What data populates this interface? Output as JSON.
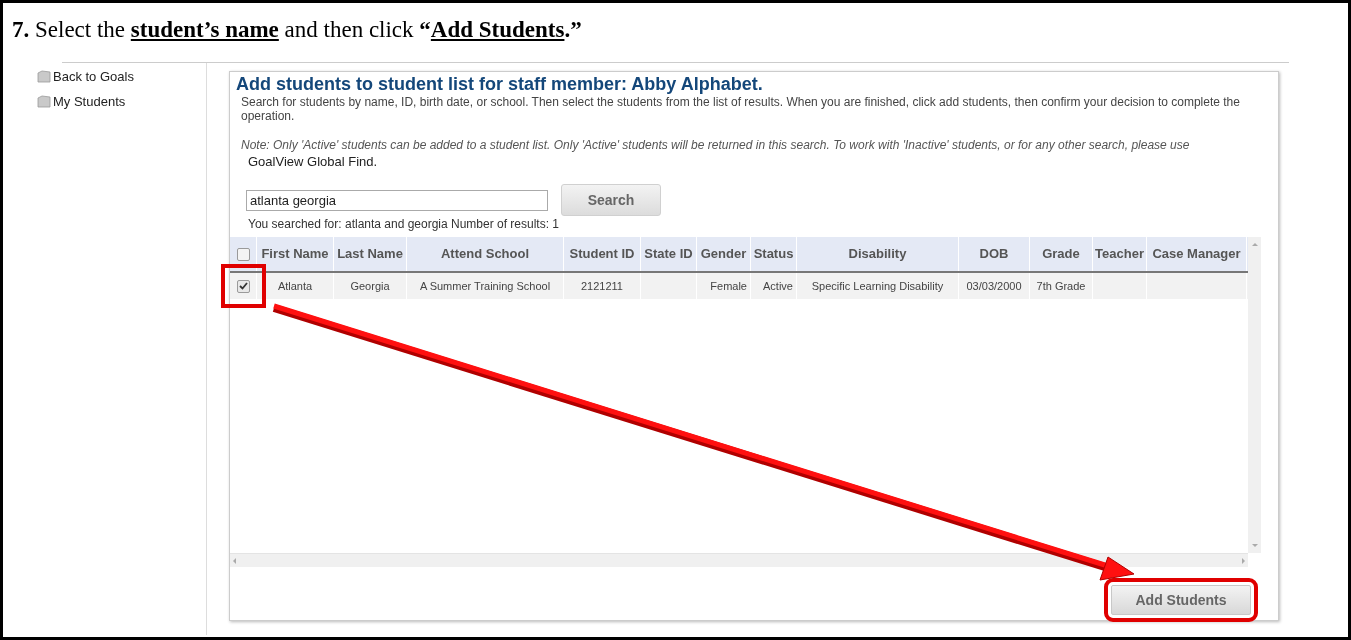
{
  "instruction": {
    "number": "7.",
    "parts": [
      {
        "text": "Select the ",
        "bold": false,
        "underline": false
      },
      {
        "text": "student’s name",
        "bold": true,
        "underline": true
      },
      {
        "text": " and then click ",
        "bold": false,
        "underline": false
      },
      {
        "text": "“",
        "bold": true,
        "underline": false
      },
      {
        "text": "Add Students",
        "bold": true,
        "underline": true
      },
      {
        "text": ".”",
        "bold": true,
        "underline": false
      }
    ]
  },
  "sidebar": {
    "items": [
      {
        "label": "Back to Goals"
      },
      {
        "label": "My Students"
      }
    ]
  },
  "panel": {
    "title": "Add students to student list for staff member: Abby Alphabet.",
    "description": "Search for students by name, ID, birth date, or school. Then select the students from the list of results. When you are finished, click add students, then confirm your decision to complete the operation.",
    "note": "Note: Only 'Active' students can be added to a student list. Only 'Active' students will be returned in this search. To work with 'Inactive' students, or for any other search, please use",
    "global_find_link": "GoalView Global Find.",
    "search_value": "atlanta georgia",
    "search_button": "Search",
    "searched_for": "You searched for: atlanta and georgia",
    "result_count": "Number of results: 1",
    "add_button": "Add Students"
  },
  "table": {
    "select_all_checked": false,
    "columns": [
      "First Name",
      "Last Name",
      "Attend School",
      "Student ID",
      "State ID",
      "Gender",
      "Status",
      "Disability",
      "DOB",
      "Grade",
      "Teacher",
      "Case Manager"
    ],
    "rows": [
      {
        "checked": true,
        "cells": [
          "Atlanta",
          "Georgia",
          "A Summer Training School",
          "2121211",
          "",
          "Female",
          "Active",
          "Specific Learning Disability",
          "03/03/2000",
          "7th Grade",
          "",
          ""
        ]
      }
    ]
  }
}
